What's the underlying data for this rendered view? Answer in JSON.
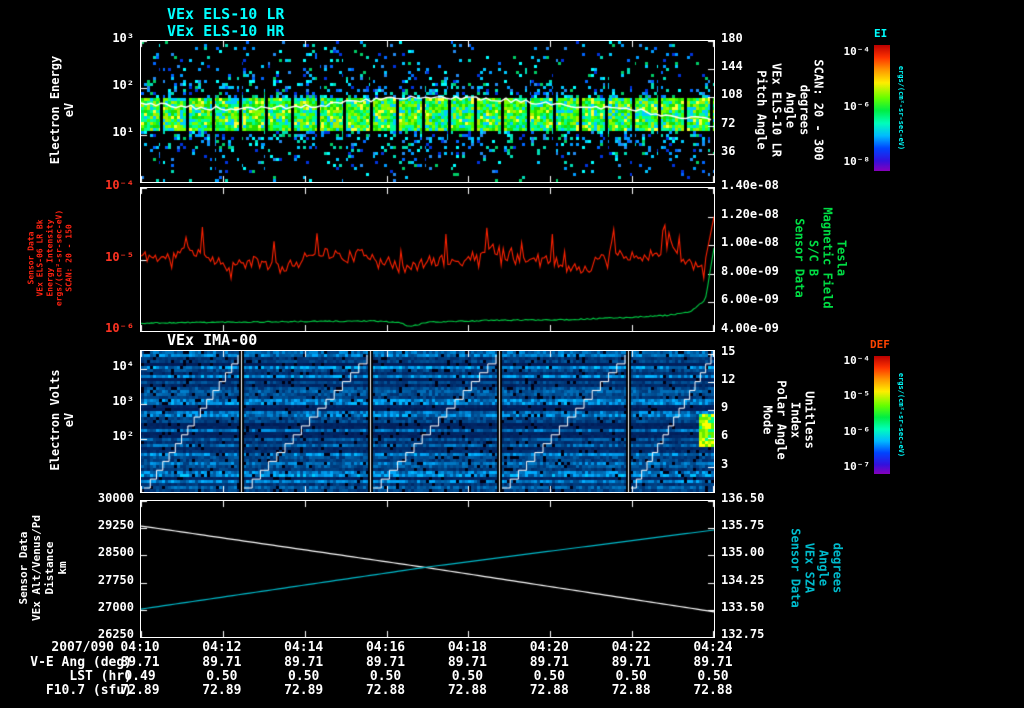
{
  "colors": {
    "background": "#000000",
    "axis": "#ffffff",
    "title_cyan": "#00ffff",
    "red": "#ff2200",
    "green": "#00cc44",
    "sza_cyan": "#00bbcc",
    "def_label": "#ff4400"
  },
  "panel1": {
    "titles": [
      "VEx ELS-10 LR",
      "VEx ELS-10 HR"
    ],
    "left_label_lines": [
      "Electron Energy",
      "eV"
    ],
    "left_ticks": [
      "10³",
      "10²",
      "10¹"
    ],
    "right_ticks": [
      "180",
      "144",
      "108",
      "72",
      "36"
    ],
    "right_label_lines": [
      "Pitch Angle",
      "VEx ELS-10 LR",
      "Angle",
      "degrees",
      "SCAN: 20 - 300"
    ],
    "colorbar": {
      "title": "EI",
      "ticks": [
        "10⁻⁴",
        "10⁻⁶",
        "10⁻⁸"
      ],
      "units": "ergs/(cm²-sr-sec-eV)"
    }
  },
  "panel2": {
    "left_label_lines": [
      "Sensor Data",
      "VEx ELS-06 LR Bk",
      "Energy Intensity",
      "ergs/(cm²-sr-sec-eV)",
      "SCAN: 20 - 150"
    ],
    "left_ticks": [
      "10⁻⁴",
      "10⁻⁵",
      "10⁻⁶"
    ],
    "right_ticks": [
      "1.40e-08",
      "1.20e-08",
      "1.00e-08",
      "8.00e-09",
      "6.00e-09",
      "4.00e-09"
    ],
    "right_label_lines": [
      "Sensor Data",
      "S/C B",
      "Magnetic Field",
      "Tesla"
    ]
  },
  "panel3": {
    "title": "VEx IMA-00",
    "left_label_lines": [
      "Electron Volts",
      "eV"
    ],
    "left_ticks": [
      "10⁴",
      "10³",
      "10²"
    ],
    "right_ticks": [
      "15",
      "12",
      "9",
      "6",
      "3"
    ],
    "right_label_lines": [
      "Mode",
      "Polar Angle",
      "Index",
      "Unitless"
    ],
    "colorbar": {
      "title": "DEF",
      "ticks": [
        "10⁻⁴",
        "10⁻⁵",
        "10⁻⁶",
        "10⁻⁷"
      ],
      "units": "ergs/(cm²-sr-sec-eV)"
    }
  },
  "panel4": {
    "left_label_lines": [
      "Sensor Data",
      "VEx Alt/Venus/Pd",
      "Distance",
      "km"
    ],
    "left_ticks": [
      "30000",
      "29250",
      "28500",
      "27750",
      "27000",
      "26250"
    ],
    "right_ticks": [
      "136.50",
      "135.75",
      "135.00",
      "134.25",
      "133.50",
      "132.75"
    ],
    "right_label_lines": [
      "Sensor Data",
      "VEx SZA",
      "Angle",
      "degrees"
    ]
  },
  "footer": {
    "date_label": "2007/090",
    "time_ticks": [
      "04:10",
      "04:12",
      "04:14",
      "04:16",
      "04:18",
      "04:20",
      "04:22",
      "04:24"
    ],
    "rows": [
      {
        "label": "V-E Ang (deg)",
        "values": [
          "89.71",
          "89.71",
          "89.71",
          "89.71",
          "89.71",
          "89.71",
          "89.71",
          "89.71"
        ]
      },
      {
        "label": "LST (hr)",
        "values": [
          "0.49",
          "0.50",
          "0.50",
          "0.50",
          "0.50",
          "0.50",
          "0.50",
          "0.50"
        ]
      },
      {
        "label": "F10.7 (sfu)",
        "values": [
          "72.89",
          "72.89",
          "72.89",
          "72.88",
          "72.88",
          "72.88",
          "72.88",
          "72.88"
        ]
      }
    ]
  },
  "chart_data": [
    {
      "type": "heatmap",
      "id": "els_spectrogram",
      "title": "VEx ELS-10 LR / VEx ELS-10 HR",
      "ylabel": "Electron Energy (eV)",
      "yscale": "log",
      "yrange": [
        1,
        1000
      ],
      "x_time_range": [
        "2007/090 04:10",
        "2007/090 04:24"
      ],
      "right_axis": {
        "label": "Pitch Angle (degrees) SCAN: 20 - 300",
        "ticks": [
          180,
          144,
          108,
          72,
          36
        ]
      },
      "colorbar": {
        "label": "EI",
        "units": "ergs/(cm²-sr-sec-eV)",
        "range_log10": [
          -8,
          -4
        ]
      },
      "band_top_frac": 0.39,
      "band_bot_frac": 0.63,
      "trace_frac": 0.44,
      "seed": 7,
      "description": "Bright green/yellow electron band near 20-60 eV with white mean-energy trace, scattered cyan/blue counts above and below, periodic thin vertical data gaps"
    },
    {
      "type": "line",
      "id": "intensity_and_bfield",
      "series": [
        {
          "name": "VEx ELS-06 LR Bk Energy Intensity",
          "units": "ergs/(cm²-sr-sec-eV)",
          "color": "#ff2200",
          "axis": "left",
          "yscale": "log10",
          "ylim": [
            -6,
            -4
          ],
          "base_log10": -5.0,
          "noise_log10": 0.17,
          "end_log10": -4.4,
          "seed": 11
        },
        {
          "name": "S/C B Magnetic Field",
          "units": "Tesla",
          "color": "#00cc44",
          "axis": "right",
          "ylim": [
            4e-09,
            1.4e-08
          ],
          "x_frac": [
            0,
            0.1,
            0.25,
            0.4,
            0.45,
            0.47,
            0.5,
            0.62,
            0.75,
            0.85,
            0.92,
            0.96,
            0.985,
            1.0
          ],
          "values": [
            4.55e-09,
            4.6e-09,
            4.65e-09,
            4.7e-09,
            4.6e-09,
            4.3e-09,
            4.62e-09,
            4.75e-09,
            4.8e-09,
            4.95e-09,
            5.1e-09,
            5.35e-09,
            6.2e-09,
            9.8e-09
          ]
        }
      ]
    },
    {
      "type": "heatmap",
      "id": "ima_spectrogram",
      "title": "VEx IMA-00",
      "ylabel": "Electron Volts (eV)",
      "yscale": "log",
      "yrange": [
        10,
        30000
      ],
      "right_axis": {
        "label": "Mode / Polar Angle Index (Unitless)",
        "range": [
          0,
          15
        ],
        "pattern": "repeating sawtooth staircase rising 0 to 15 between white segment dividers"
      },
      "colorbar": {
        "label": "DEF",
        "units": "ergs/(cm²-sr-sec-eV)",
        "range_log10": [
          -7,
          -4
        ]
      },
      "dividers_frac": [
        0.175,
        0.4,
        0.625,
        0.85
      ],
      "seed": 13,
      "description": "Blue horizontally-banded ion energy spectrogram with white polar-angle staircase overlays and a bright yellow-green patch at the right edge"
    },
    {
      "type": "line",
      "id": "ephemeris",
      "series": [
        {
          "name": "VEx Alt/Venus/Pd Distance",
          "units": "km",
          "color": "#ffffff",
          "axis": "left",
          "ylim": [
            26250,
            30000
          ],
          "x_frac": [
            0,
            0.5,
            1
          ],
          "values": [
            29310,
            28160,
            26945
          ]
        },
        {
          "name": "VEx SZA Angle",
          "units": "degrees",
          "color": "#00bbcc",
          "axis": "right",
          "ylim": [
            132.75,
            136.5
          ],
          "x_frac": [
            0,
            0.5,
            1
          ],
          "values": [
            133.52,
            134.68,
            135.7
          ]
        }
      ]
    }
  ]
}
